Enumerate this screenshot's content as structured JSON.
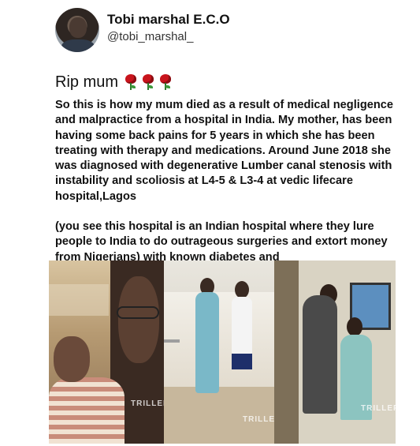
{
  "author": {
    "display_name": "Tobi marshal E.C.O",
    "handle": "@tobi_marshal_"
  },
  "post": {
    "title": "Rip mum",
    "emoji": [
      "rose-icon",
      "rose-icon",
      "rose-icon"
    ],
    "paragraphs": [
      "So this is how my mum died as a result of medical negligence and malpractice from a hospital in India. My mother, has been having some back pains for 5 years in which she has been treating with therapy and medications. Around June 2018 she was diagnosed with degenerative Lumber canal stenosis with instability and scoliosis at L4-5 & L3-4 at vedic lifecare hospital,Lagos",
      "(you see this hospital is an Indian hospital where they lure people to India to do outrageous surgeries and extort money from Nigerians) with known diabetes and"
    ]
  },
  "media": {
    "watermarks": [
      "TRILLER",
      "TRILLER",
      "TRILLER"
    ],
    "colors": {
      "rose": "#c8141c",
      "scrubs": "#7ab8c8"
    }
  }
}
